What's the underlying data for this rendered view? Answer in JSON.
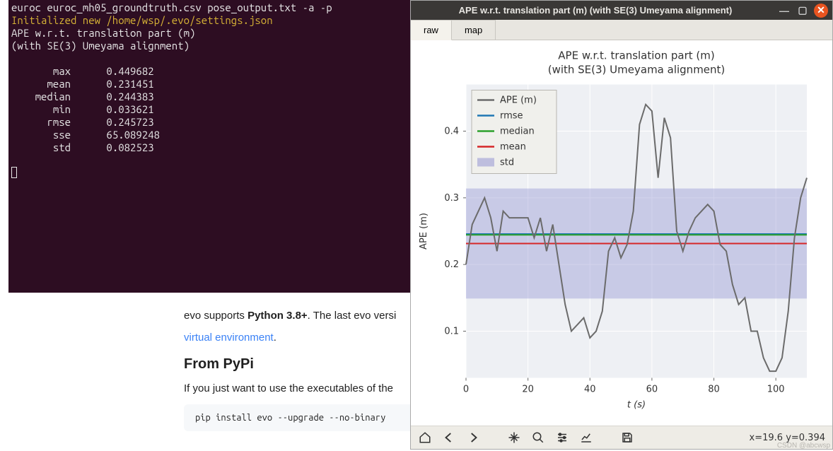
{
  "terminal": {
    "cmd": "euroc euroc_mh05_groundtruth.csv pose_output.txt -a -p",
    "init_msg": "Initialized new /home/wsp/.evo/settings.json",
    "header1": "APE w.r.t. translation part (m)",
    "header2": "(with SE(3) Umeyama alignment)",
    "stats": {
      "max": {
        "label": "max",
        "value": "0.449682"
      },
      "mean": {
        "label": "mean",
        "value": "0.231451"
      },
      "median": {
        "label": "median",
        "value": "0.244383"
      },
      "min": {
        "label": "min",
        "value": "0.033621"
      },
      "rmse": {
        "label": "rmse",
        "value": "0.245723"
      },
      "sse": {
        "label": "sse",
        "value": "65.089248"
      },
      "std": {
        "label": "std",
        "value": "0.082523"
      }
    }
  },
  "doc": {
    "supports_pre": "evo supports ",
    "py_ver": "Python 3.8+",
    "supports_post": ". The last evo versi",
    "link": "virtual environment",
    "period": ".",
    "heading": "From PyPi",
    "para2": "If you just want to use the executables of the ",
    "code": "pip install evo --upgrade --no-binary"
  },
  "plot_window": {
    "title": "APE w.r.t. translation part (m) (with SE(3) Umeyama alignment)",
    "tabs": {
      "raw": "raw",
      "map": "map"
    },
    "coords": "x=19.6 y=0.394",
    "toolbar": {
      "home": "home",
      "back": "back",
      "forward": "forward",
      "pan": "pan",
      "zoom": "zoom",
      "config": "configure-subplots",
      "edit": "edit-parameters",
      "save": "save-figure"
    }
  },
  "watermark": "CSDN @abcwsp",
  "chart_data": {
    "type": "line",
    "title": "APE w.r.t. translation part (m)",
    "subtitle": "(with SE(3) Umeyama alignment)",
    "xlabel": "t (s)",
    "ylabel": "APE (m)",
    "xlim": [
      0,
      110
    ],
    "ylim": [
      0.03,
      0.47
    ],
    "xticks": [
      0,
      20,
      40,
      60,
      80,
      100
    ],
    "yticks": [
      0.1,
      0.2,
      0.3,
      0.4
    ],
    "hlines": {
      "rmse": {
        "value": 0.245723,
        "color": "#1f77b4"
      },
      "median": {
        "value": 0.244383,
        "color": "#2ca02c"
      },
      "mean": {
        "value": 0.231451,
        "color": "#d62728"
      }
    },
    "std_band": {
      "center": 0.231451,
      "half": 0.082523,
      "color": "#8b8bcf"
    },
    "legend": [
      "APE (m)",
      "rmse",
      "median",
      "mean",
      "std"
    ],
    "legend_colors": {
      "APE (m)": "#6b6b6b",
      "rmse": "#1f77b4",
      "median": "#2ca02c",
      "mean": "#d62728",
      "std": "#8b8bcf"
    },
    "series": [
      {
        "name": "APE (m)",
        "color": "#6b6b6b",
        "x": [
          0,
          2,
          4,
          6,
          8,
          10,
          12,
          14,
          16,
          18,
          20,
          22,
          24,
          26,
          28,
          30,
          32,
          34,
          36,
          38,
          40,
          42,
          44,
          46,
          48,
          50,
          52,
          54,
          56,
          58,
          60,
          62,
          64,
          66,
          68,
          70,
          72,
          74,
          76,
          78,
          80,
          82,
          84,
          86,
          88,
          90,
          92,
          94,
          96,
          98,
          100,
          102,
          104,
          106,
          108,
          110
        ],
        "y": [
          0.2,
          0.26,
          0.28,
          0.3,
          0.27,
          0.22,
          0.28,
          0.27,
          0.27,
          0.27,
          0.27,
          0.24,
          0.27,
          0.22,
          0.26,
          0.2,
          0.14,
          0.1,
          0.11,
          0.12,
          0.09,
          0.1,
          0.13,
          0.22,
          0.24,
          0.21,
          0.23,
          0.28,
          0.41,
          0.44,
          0.43,
          0.33,
          0.42,
          0.39,
          0.25,
          0.22,
          0.25,
          0.27,
          0.28,
          0.29,
          0.28,
          0.23,
          0.22,
          0.17,
          0.14,
          0.15,
          0.1,
          0.1,
          0.06,
          0.04,
          0.04,
          0.06,
          0.13,
          0.24,
          0.3,
          0.33
        ]
      }
    ]
  }
}
